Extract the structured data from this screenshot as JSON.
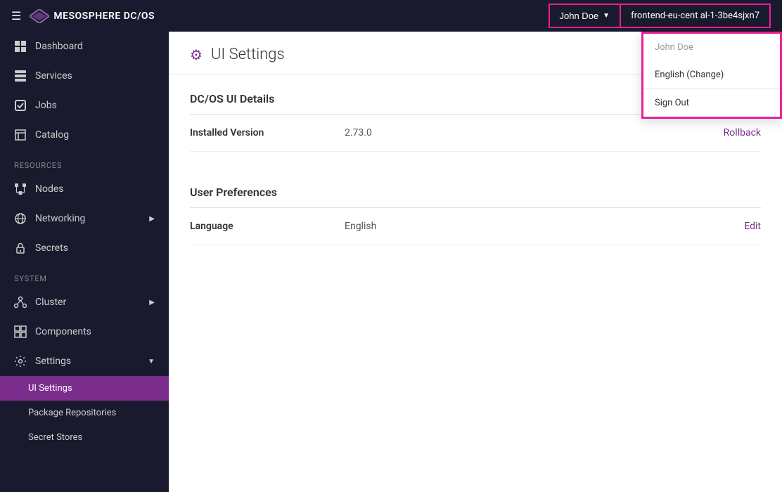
{
  "topbar": {
    "logo_text": "MESOSPHERE DC/OS",
    "user_name": "John Doe",
    "cluster_id": "frontend-eu-cent al-1-3be4sjxn7",
    "hamburger": "☰"
  },
  "dropdown": {
    "user_label": "John Doe",
    "language_option": "English (Change)",
    "sign_out": "Sign Out"
  },
  "sidebar": {
    "nav_items": [
      {
        "id": "dashboard",
        "label": "Dashboard",
        "icon": "dashboard"
      },
      {
        "id": "services",
        "label": "Services",
        "icon": "services"
      },
      {
        "id": "jobs",
        "label": "Jobs",
        "icon": "jobs"
      },
      {
        "id": "catalog",
        "label": "Catalog",
        "icon": "catalog"
      }
    ],
    "resources_label": "Resources",
    "resources_items": [
      {
        "id": "nodes",
        "label": "Nodes",
        "icon": "nodes"
      },
      {
        "id": "networking",
        "label": "Networking",
        "icon": "networking",
        "has_chevron": true
      },
      {
        "id": "secrets",
        "label": "Secrets",
        "icon": "secrets"
      }
    ],
    "system_label": "System",
    "system_items": [
      {
        "id": "cluster",
        "label": "Cluster",
        "icon": "cluster",
        "has_chevron": true
      },
      {
        "id": "components",
        "label": "Components",
        "icon": "components"
      },
      {
        "id": "settings",
        "label": "Settings",
        "icon": "settings",
        "has_chevron": true,
        "expanded": true
      }
    ],
    "settings_sub_items": [
      {
        "id": "ui-settings",
        "label": "UI Settings",
        "active": true
      },
      {
        "id": "package-repos",
        "label": "Package Repositories",
        "active": false
      },
      {
        "id": "secret-stores",
        "label": "Secret Stores",
        "active": false
      }
    ]
  },
  "content": {
    "page_title": "UI Settings",
    "sections": [
      {
        "id": "dc-os-ui-details",
        "title": "DC/OS UI Details",
        "rows": [
          {
            "label": "Installed Version",
            "value": "2.73.0",
            "action": "Rollback",
            "action_id": "rollback"
          }
        ]
      },
      {
        "id": "user-preferences",
        "title": "User Preferences",
        "rows": [
          {
            "label": "Language",
            "value": "English",
            "action": "Edit",
            "action_id": "edit-language"
          }
        ]
      }
    ]
  }
}
